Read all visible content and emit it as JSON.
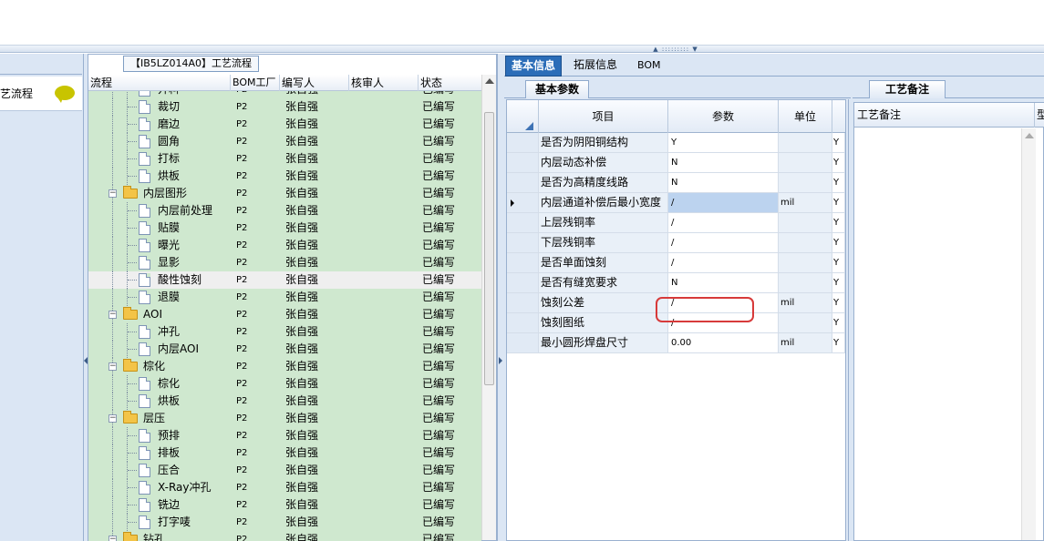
{
  "left_nav": {
    "item_label": "艺流程"
  },
  "tree": {
    "title": "【IB5LZ014A0】工艺流程",
    "columns": {
      "flow": "流程",
      "bom": "BOM工厂",
      "writer": "编写人",
      "reviewer": "核审人",
      "status": "状态"
    },
    "rows": [
      {
        "name": "开料",
        "type": "doc",
        "bom": "P2",
        "writer": "张自强",
        "reviewer": "",
        "status": "已编写",
        "level": 1
      },
      {
        "name": "裁切",
        "type": "doc",
        "bom": "P2",
        "writer": "张自强",
        "reviewer": "",
        "status": "已编写",
        "level": 1
      },
      {
        "name": "磨边",
        "type": "doc",
        "bom": "P2",
        "writer": "张自强",
        "reviewer": "",
        "status": "已编写",
        "level": 1
      },
      {
        "name": "圆角",
        "type": "doc",
        "bom": "P2",
        "writer": "张自强",
        "reviewer": "",
        "status": "已编写",
        "level": 1
      },
      {
        "name": "打标",
        "type": "doc",
        "bom": "P2",
        "writer": "张自强",
        "reviewer": "",
        "status": "已编写",
        "level": 1
      },
      {
        "name": "烘板",
        "type": "doc",
        "bom": "P2",
        "writer": "张自强",
        "reviewer": "",
        "status": "已编写",
        "level": 1
      },
      {
        "name": "内层图形",
        "type": "folder",
        "bom": "P2",
        "writer": "张自强",
        "reviewer": "",
        "status": "已编写",
        "level": 0
      },
      {
        "name": "内层前处理",
        "type": "doc",
        "bom": "P2",
        "writer": "张自强",
        "reviewer": "",
        "status": "已编写",
        "level": 1
      },
      {
        "name": "贴膜",
        "type": "doc",
        "bom": "P2",
        "writer": "张自强",
        "reviewer": "",
        "status": "已编写",
        "level": 1
      },
      {
        "name": "曝光",
        "type": "doc",
        "bom": "P2",
        "writer": "张自强",
        "reviewer": "",
        "status": "已编写",
        "level": 1
      },
      {
        "name": "显影",
        "type": "doc",
        "bom": "P2",
        "writer": "张自强",
        "reviewer": "",
        "status": "已编写",
        "level": 1
      },
      {
        "name": "酸性蚀刻",
        "type": "doc",
        "bom": "P2",
        "writer": "张自强",
        "reviewer": "",
        "status": "已编写",
        "level": 1,
        "selected": true
      },
      {
        "name": "退膜",
        "type": "doc",
        "bom": "P2",
        "writer": "张自强",
        "reviewer": "",
        "status": "已编写",
        "level": 1
      },
      {
        "name": "AOI",
        "type": "folder",
        "bom": "P2",
        "writer": "张自强",
        "reviewer": "",
        "status": "已编写",
        "level": 0
      },
      {
        "name": "冲孔",
        "type": "doc",
        "bom": "P2",
        "writer": "张自强",
        "reviewer": "",
        "status": "已编写",
        "level": 1
      },
      {
        "name": "内层AOI",
        "type": "doc",
        "bom": "P2",
        "writer": "张自强",
        "reviewer": "",
        "status": "已编写",
        "level": 1
      },
      {
        "name": "棕化",
        "type": "folder",
        "bom": "P2",
        "writer": "张自强",
        "reviewer": "",
        "status": "已编写",
        "level": 0
      },
      {
        "name": "棕化",
        "type": "doc",
        "bom": "P2",
        "writer": "张自强",
        "reviewer": "",
        "status": "已编写",
        "level": 1
      },
      {
        "name": "烘板",
        "type": "doc",
        "bom": "P2",
        "writer": "张自强",
        "reviewer": "",
        "status": "已编写",
        "level": 1
      },
      {
        "name": "层压",
        "type": "folder",
        "bom": "P2",
        "writer": "张自强",
        "reviewer": "",
        "status": "已编写",
        "level": 0
      },
      {
        "name": "预排",
        "type": "doc",
        "bom": "P2",
        "writer": "张自强",
        "reviewer": "",
        "status": "已编写",
        "level": 1
      },
      {
        "name": "排板",
        "type": "doc",
        "bom": "P2",
        "writer": "张自强",
        "reviewer": "",
        "status": "已编写",
        "level": 1
      },
      {
        "name": "压合",
        "type": "doc",
        "bom": "P2",
        "writer": "张自强",
        "reviewer": "",
        "status": "已编写",
        "level": 1
      },
      {
        "name": "X-Ray冲孔",
        "type": "doc",
        "bom": "P2",
        "writer": "张自强",
        "reviewer": "",
        "status": "已编写",
        "level": 1
      },
      {
        "name": "铣边",
        "type": "doc",
        "bom": "P2",
        "writer": "张自强",
        "reviewer": "",
        "status": "已编写",
        "level": 1
      },
      {
        "name": "打字唛",
        "type": "doc",
        "bom": "P2",
        "writer": "张自强",
        "reviewer": "",
        "status": "已编写",
        "level": 1
      },
      {
        "name": "钻孔",
        "type": "folder",
        "bom": "P2",
        "writer": "张自强",
        "reviewer": "",
        "status": "已编写",
        "level": 0
      }
    ]
  },
  "tabs": {
    "basic": "基本信息",
    "extended": "拓展信息",
    "bom": "BOM"
  },
  "params": {
    "subtab": "基本参数",
    "columns": {
      "item": "项目",
      "param": "参数",
      "unit": "单位"
    },
    "rows": [
      {
        "item": "是否为阴阳铜结构",
        "param": "Y",
        "unit": "",
        "flag": "Y"
      },
      {
        "item": "内层动态补偿",
        "param": "N",
        "unit": "",
        "flag": "Y"
      },
      {
        "item": "是否为高精度线路",
        "param": "N",
        "unit": "",
        "flag": "Y"
      },
      {
        "item": "内层通道补偿后最小宽度",
        "param": "/",
        "unit": "mil",
        "flag": "Y",
        "current": true
      },
      {
        "item": "上层残铜率",
        "param": "/",
        "unit": "",
        "flag": "Y"
      },
      {
        "item": "下层残铜率",
        "param": "/",
        "unit": "",
        "flag": "Y"
      },
      {
        "item": "是否单面蚀刻",
        "param": "/",
        "unit": "",
        "flag": "Y",
        "marked": true
      },
      {
        "item": "是否有缝宽要求",
        "param": "N",
        "unit": "",
        "flag": "Y"
      },
      {
        "item": "蚀刻公差",
        "param": "/",
        "unit": "mil",
        "flag": "Y"
      },
      {
        "item": "蚀刻图纸",
        "param": "/",
        "unit": "",
        "flag": "Y"
      },
      {
        "item": "最小圆形焊盘尺寸",
        "param": "0.00",
        "unit": "mil",
        "flag": "Y"
      }
    ]
  },
  "notes": {
    "tab": "工艺备注",
    "column": "工艺备注",
    "column2": "型"
  },
  "colors": {
    "tree_row_bg": "#cfe8cf",
    "active_tab": "#2b6db8",
    "red_mark": "#d73a3a"
  }
}
